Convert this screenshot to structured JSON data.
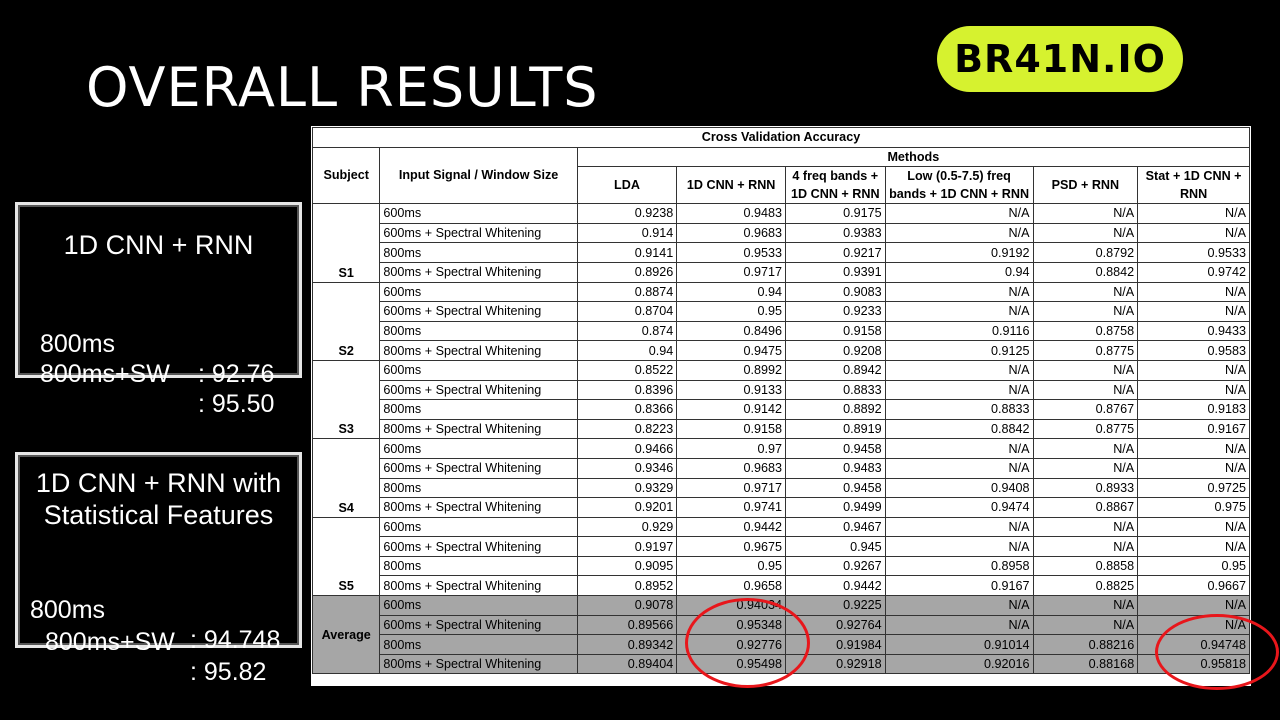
{
  "title": "OVERALL RESULTS",
  "logo": "BR41N.IO",
  "panel1": {
    "title": "1D CNN + RNN",
    "rows": [
      {
        "label": "800ms",
        "value": ": 92.76"
      },
      {
        "label": "800ms+SW",
        "value": ": 95.50"
      }
    ]
  },
  "panel2": {
    "title_line1": "1D CNN + RNN with",
    "title_line2": "Statistical Features",
    "rows": [
      {
        "label": "800ms",
        "value": ": 94.748"
      },
      {
        "label": "800ms+SW",
        "value": ": 95.82"
      }
    ]
  },
  "table": {
    "caption": "Cross Validation Accuracy",
    "subject_header": "Subject",
    "signal_header": "Input Signal / Window Size",
    "methods_header": "Methods",
    "columns": [
      "LDA",
      "1D CNN + RNN",
      "4 freq bands + 1D CNN + RNN",
      "Low (0.5-7.5) freq bands + 1D CNN + RNN",
      "PSD + RNN",
      "Stat + 1D CNN + RNN"
    ],
    "groups": [
      {
        "subject": "S1",
        "rows": [
          {
            "signal": "600ms",
            "values": [
              "0.9238",
              "0.9483",
              "0.9175",
              "N/A",
              "N/A",
              "N/A"
            ]
          },
          {
            "signal": "600ms + Spectral Whitening",
            "values": [
              "0.914",
              "0.9683",
              "0.9383",
              "N/A",
              "N/A",
              "N/A"
            ]
          },
          {
            "signal": "800ms",
            "values": [
              "0.9141",
              "0.9533",
              "0.9217",
              "0.9192",
              "0.8792",
              "0.9533"
            ]
          },
          {
            "signal": "800ms + Spectral Whitening",
            "values": [
              "0.8926",
              "0.9717",
              "0.9391",
              "0.94",
              "0.8842",
              "0.9742"
            ]
          }
        ]
      },
      {
        "subject": "S2",
        "rows": [
          {
            "signal": "600ms",
            "values": [
              "0.8874",
              "0.94",
              "0.9083",
              "N/A",
              "N/A",
              "N/A"
            ]
          },
          {
            "signal": "600ms + Spectral Whitening",
            "values": [
              "0.8704",
              "0.95",
              "0.9233",
              "N/A",
              "N/A",
              "N/A"
            ]
          },
          {
            "signal": "800ms",
            "values": [
              "0.874",
              "0.8496",
              "0.9158",
              "0.9116",
              "0.8758",
              "0.9433"
            ]
          },
          {
            "signal": "800ms + Spectral Whitening",
            "values": [
              "0.94",
              "0.9475",
              "0.9208",
              "0.9125",
              "0.8775",
              "0.9583"
            ]
          }
        ]
      },
      {
        "subject": "S3",
        "rows": [
          {
            "signal": "600ms",
            "values": [
              "0.8522",
              "0.8992",
              "0.8942",
              "N/A",
              "N/A",
              "N/A"
            ]
          },
          {
            "signal": "600ms + Spectral Whitening",
            "values": [
              "0.8396",
              "0.9133",
              "0.8833",
              "N/A",
              "N/A",
              "N/A"
            ]
          },
          {
            "signal": "800ms",
            "values": [
              "0.8366",
              "0.9142",
              "0.8892",
              "0.8833",
              "0.8767",
              "0.9183"
            ]
          },
          {
            "signal": "800ms + Spectral Whitening",
            "values": [
              "0.8223",
              "0.9158",
              "0.8919",
              "0.8842",
              "0.8775",
              "0.9167"
            ]
          }
        ]
      },
      {
        "subject": "S4",
        "rows": [
          {
            "signal": "600ms",
            "values": [
              "0.9466",
              "0.97",
              "0.9458",
              "N/A",
              "N/A",
              "N/A"
            ]
          },
          {
            "signal": "600ms + Spectral Whitening",
            "values": [
              "0.9346",
              "0.9683",
              "0.9483",
              "N/A",
              "N/A",
              "N/A"
            ]
          },
          {
            "signal": "800ms",
            "values": [
              "0.9329",
              "0.9717",
              "0.9458",
              "0.9408",
              "0.8933",
              "0.9725"
            ]
          },
          {
            "signal": "800ms + Spectral Whitening",
            "values": [
              "0.9201",
              "0.9741",
              "0.9499",
              "0.9474",
              "0.8867",
              "0.975"
            ]
          }
        ]
      },
      {
        "subject": "S5",
        "rows": [
          {
            "signal": "600ms",
            "values": [
              "0.929",
              "0.9442",
              "0.9467",
              "N/A",
              "N/A",
              "N/A"
            ]
          },
          {
            "signal": "600ms + Spectral Whitening",
            "values": [
              "0.9197",
              "0.9675",
              "0.945",
              "N/A",
              "N/A",
              "N/A"
            ]
          },
          {
            "signal": "800ms",
            "values": [
              "0.9095",
              "0.95",
              "0.9267",
              "0.8958",
              "0.8858",
              "0.95"
            ]
          },
          {
            "signal": "800ms + Spectral Whitening",
            "values": [
              "0.8952",
              "0.9658",
              "0.9442",
              "0.9167",
              "0.8825",
              "0.9667"
            ]
          }
        ]
      },
      {
        "subject": "Average",
        "average": true,
        "rows": [
          {
            "signal": "600ms",
            "values": [
              "0.9078",
              "0.94034",
              "0.9225",
              "N/A",
              "N/A",
              "N/A"
            ]
          },
          {
            "signal": "600ms + Spectral Whitening",
            "values": [
              "0.89566",
              "0.95348",
              "0.92764",
              "N/A",
              "N/A",
              "N/A"
            ]
          },
          {
            "signal": "800ms",
            "values": [
              "0.89342",
              "0.92776",
              "0.91984",
              "0.91014",
              "0.88216",
              "0.94748"
            ]
          },
          {
            "signal": "800ms + Spectral Whitening",
            "values": [
              "0.89404",
              "0.95498",
              "0.92918",
              "0.92016",
              "0.88168",
              "0.95818"
            ]
          }
        ]
      }
    ]
  },
  "highlight_color": "#e8161b",
  "logo_color": "#d6f22f"
}
